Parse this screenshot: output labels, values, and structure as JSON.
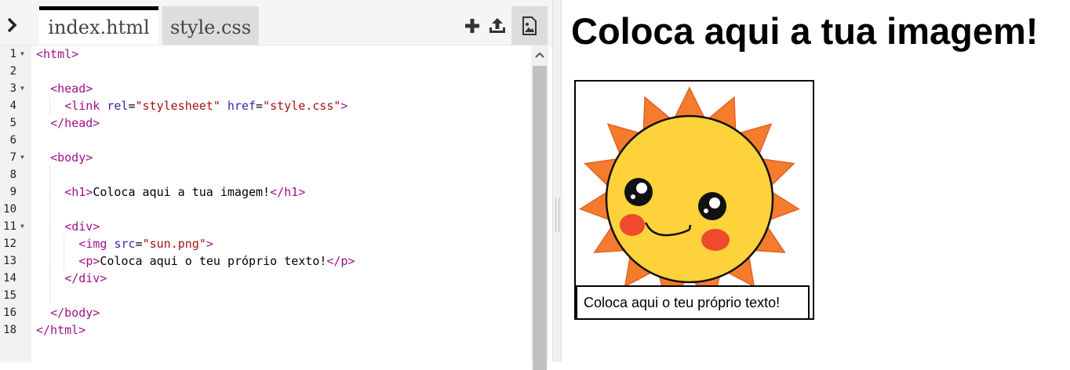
{
  "editor": {
    "tabs": [
      {
        "label": "index.html",
        "active": true
      },
      {
        "label": "style.css",
        "active": false
      }
    ],
    "toolbar_icons": [
      "chevron-right-icon",
      "plus-icon",
      "upload-icon",
      "image-icon"
    ],
    "colors": {
      "tag": "#a0108c",
      "attr": "#3a1fb5",
      "string": "#a51111",
      "active_tab_border": "#000000"
    },
    "line_numbers": [
      "1",
      "2",
      "3",
      "4",
      "5",
      "6",
      "7",
      "8",
      "9",
      "10",
      "11",
      "12",
      "13",
      "14",
      "15",
      "16",
      "18"
    ],
    "code_lines": [
      [
        {
          "t": "tag",
          "v": "<html>"
        }
      ],
      [],
      [
        {
          "t": "tag",
          "v": "<head>"
        }
      ],
      [
        {
          "t": "tag",
          "v": "<link "
        },
        {
          "t": "attr",
          "v": "rel"
        },
        {
          "t": "txt",
          "v": "="
        },
        {
          "t": "str",
          "v": "\"stylesheet\""
        },
        {
          "t": "txt",
          "v": " "
        },
        {
          "t": "attr",
          "v": "href"
        },
        {
          "t": "txt",
          "v": "="
        },
        {
          "t": "str",
          "v": "\"style.css\""
        },
        {
          "t": "tag",
          "v": ">"
        }
      ],
      [
        {
          "t": "tag",
          "v": "</head>"
        }
      ],
      [],
      [
        {
          "t": "tag",
          "v": "<body>"
        }
      ],
      [],
      [
        {
          "t": "tag",
          "v": "<h1>"
        },
        {
          "t": "txt",
          "v": "Coloca aqui a tua imagem!"
        },
        {
          "t": "tag",
          "v": "</h1>"
        }
      ],
      [],
      [
        {
          "t": "tag",
          "v": "<div>"
        }
      ],
      [
        {
          "t": "tag",
          "v": "<img "
        },
        {
          "t": "attr",
          "v": "src"
        },
        {
          "t": "txt",
          "v": "="
        },
        {
          "t": "str",
          "v": "\"sun.png\""
        },
        {
          "t": "tag",
          "v": ">"
        }
      ],
      [
        {
          "t": "tag",
          "v": "<p>"
        },
        {
          "t": "txt",
          "v": "Coloca aqui o teu próprio texto!"
        },
        {
          "t": "tag",
          "v": "</p>"
        }
      ],
      [
        {
          "t": "tag",
          "v": "</div>"
        }
      ],
      [],
      [
        {
          "t": "tag",
          "v": "</body>"
        }
      ],
      [
        {
          "t": "tag",
          "v": "</html>"
        }
      ]
    ],
    "fold_lines": [
      "1",
      "3",
      "7",
      "11"
    ]
  },
  "preview": {
    "heading": "Coloca aqui a tua imagem!",
    "image_alt": "sun",
    "paragraph": "Coloca aqui o teu próprio texto!",
    "sun_colors": {
      "rays": "#f47c2c",
      "face": "#fdd23a",
      "cheeks": "#ef4a2c"
    }
  }
}
